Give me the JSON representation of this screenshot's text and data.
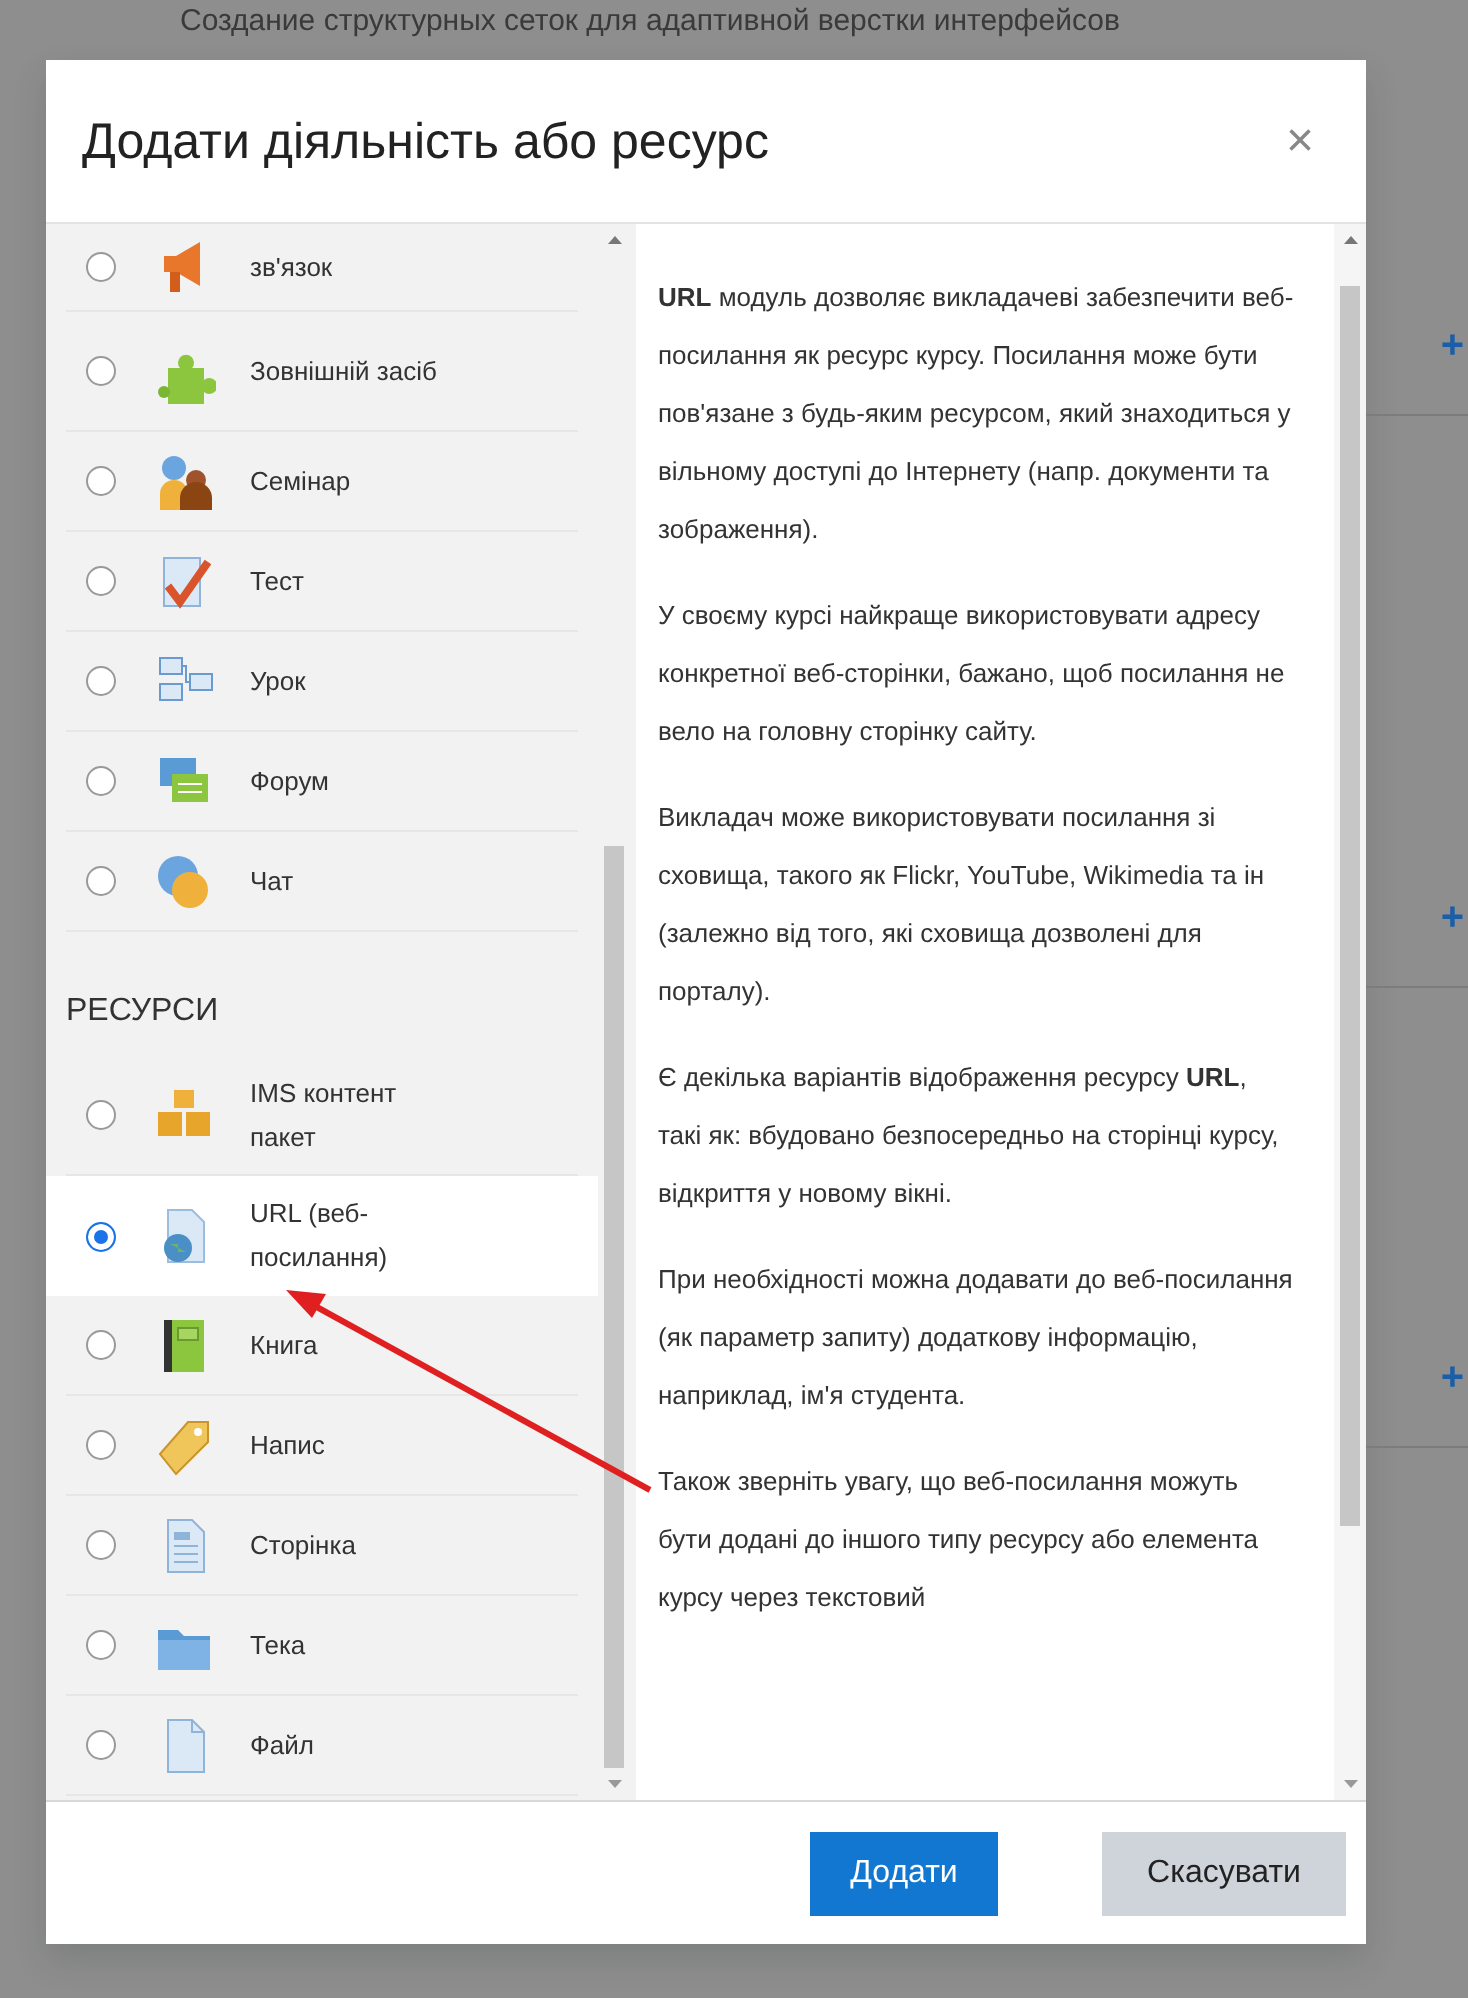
{
  "backdrop": {
    "heading": "Создание структурных сеток для адаптивной верстки интерфейсов",
    "plus_signs": [
      "+",
      "+",
      "+"
    ]
  },
  "modal": {
    "title": "Додати діяльність або ресурс",
    "close": "×"
  },
  "items": [
    {
      "kind": "item",
      "label": "зв'язок",
      "selected": false
    },
    {
      "kind": "item",
      "label": "Зовнішній засіб",
      "selected": false
    },
    {
      "kind": "item",
      "label": "Семінар",
      "selected": false
    },
    {
      "kind": "item",
      "label": "Тест",
      "selected": false
    },
    {
      "kind": "item",
      "label": "Урок",
      "selected": false
    },
    {
      "kind": "item",
      "label": "Форум",
      "selected": false
    },
    {
      "kind": "item",
      "label": "Чат",
      "selected": false
    },
    {
      "kind": "heading",
      "label": "РЕСУРСИ"
    },
    {
      "kind": "item",
      "label": "IMS контент пакет",
      "selected": false
    },
    {
      "kind": "item",
      "label": "URL (веб-посилання)",
      "selected": true
    },
    {
      "kind": "item",
      "label": "Книга",
      "selected": false
    },
    {
      "kind": "item",
      "label": "Напис",
      "selected": false
    },
    {
      "kind": "item",
      "label": "Сторінка",
      "selected": false
    },
    {
      "kind": "item",
      "label": "Тека",
      "selected": false
    },
    {
      "kind": "item",
      "label": "Файл",
      "selected": false
    }
  ],
  "description": {
    "paragraphs": [
      "**URL** модуль дозволяє викладачеві забезпечити веб-посилання як ресурс курсу. Посилання може бути пов'язане з будь-яким ресурсом, який знаходиться у вільному доступі до Інтернету (напр. документи та зображення).",
      "У своєму курсі найкраще використовувати адресу конкретної веб-сторінки, бажано, щоб посилання не вело на головну сторінку сайту.",
      "Викладач може використовувати посилання зі сховища, такого як Flickr, YouTube, Wikimedia та ін (залежно від того, які сховища дозволені для порталу).",
      "Є декілька варіантів відображення ресурсу **URL**, такі як: вбудовано безпосередньо на сторінці курсу, відкриття у новому вікні.",
      "При необхідності можна додавати до веб-посилання (як параметр запиту) додаткову інформацію, наприклад, ім'я студента.",
      "Також зверніть увагу, що веб-посилання можуть бути додані до іншого типу ресурсу або елемента курсу через текстовий"
    ]
  },
  "buttons": [
    {
      "label": "Додати",
      "kind": "primary"
    },
    {
      "label": "Скасувати",
      "kind": "secondary"
    }
  ]
}
